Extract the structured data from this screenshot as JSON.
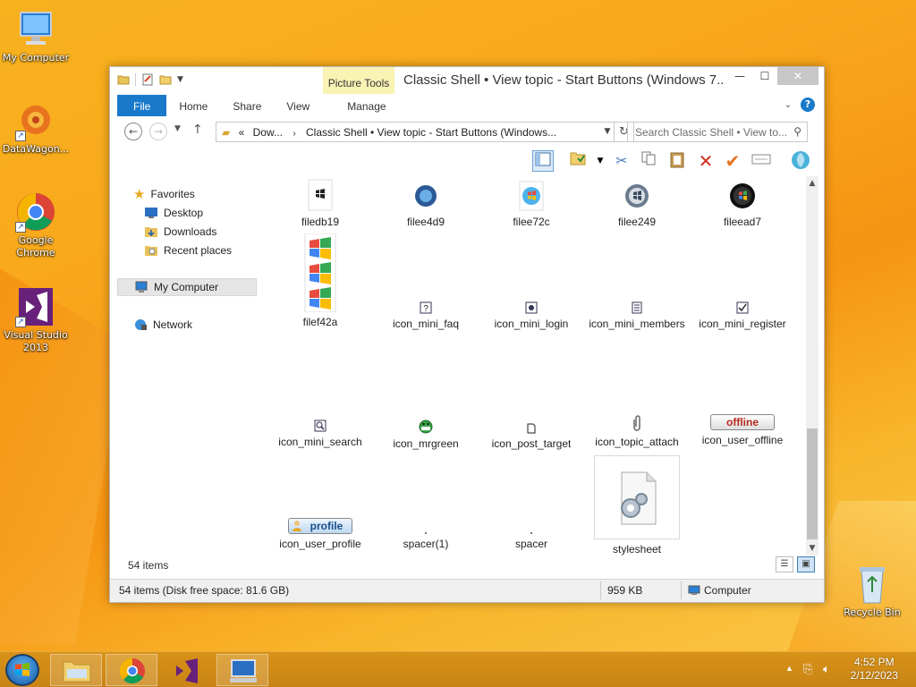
{
  "desktop": {
    "icons": [
      {
        "label": "My Computer"
      },
      {
        "label": "DataWagon..."
      },
      {
        "label": "Google Chrome"
      },
      {
        "label": "Visual Studio 2013"
      },
      {
        "label": "Recycle Bin"
      }
    ]
  },
  "window": {
    "title": "Classic Shell • View topic - Start Buttons (Windows 7...",
    "picture_tools": "Picture Tools",
    "tabs": [
      "File",
      "Home",
      "Share",
      "View",
      "Manage"
    ],
    "address": {
      "prefix": "«",
      "crumbs": [
        "Dow...",
        "Classic Shell • View topic - Start Buttons (Windows..."
      ]
    },
    "search_placeholder": "Search Classic Shell • View to...",
    "nav": {
      "favorites": "Favorites",
      "desktop": "Desktop",
      "downloads": "Downloads",
      "recent": "Recent places",
      "computer": "My Computer",
      "network": "Network"
    },
    "files": [
      {
        "name": "filedb19"
      },
      {
        "name": "filee4d9"
      },
      {
        "name": "filee72c"
      },
      {
        "name": "filee249"
      },
      {
        "name": "fileead7"
      },
      {
        "name": "filef42a"
      },
      {
        "name": "icon_mini_faq"
      },
      {
        "name": "icon_mini_login"
      },
      {
        "name": "icon_mini_members"
      },
      {
        "name": "icon_mini_register"
      },
      {
        "name": "icon_mini_search"
      },
      {
        "name": "icon_mrgreen"
      },
      {
        "name": "icon_post_target"
      },
      {
        "name": "icon_topic_attach"
      },
      {
        "name": "icon_user_offline"
      },
      {
        "name": "icon_user_profile"
      },
      {
        "name": "spacer(1)"
      },
      {
        "name": "spacer"
      },
      {
        "name": "stylesheet"
      }
    ],
    "badges": {
      "offline": "offline",
      "profile": "profile"
    },
    "item_count": "54 items",
    "status": {
      "left": "54 items (Disk free space: 81.6 GB)",
      "size": "959 KB",
      "location": "Computer"
    }
  },
  "taskbar": {
    "time": "4:52 PM",
    "date": "2/12/2023"
  },
  "colors": {
    "accent": "#1979ca",
    "picture_tools_bg": "#f9f3b4",
    "taskbar": "#c98414"
  }
}
